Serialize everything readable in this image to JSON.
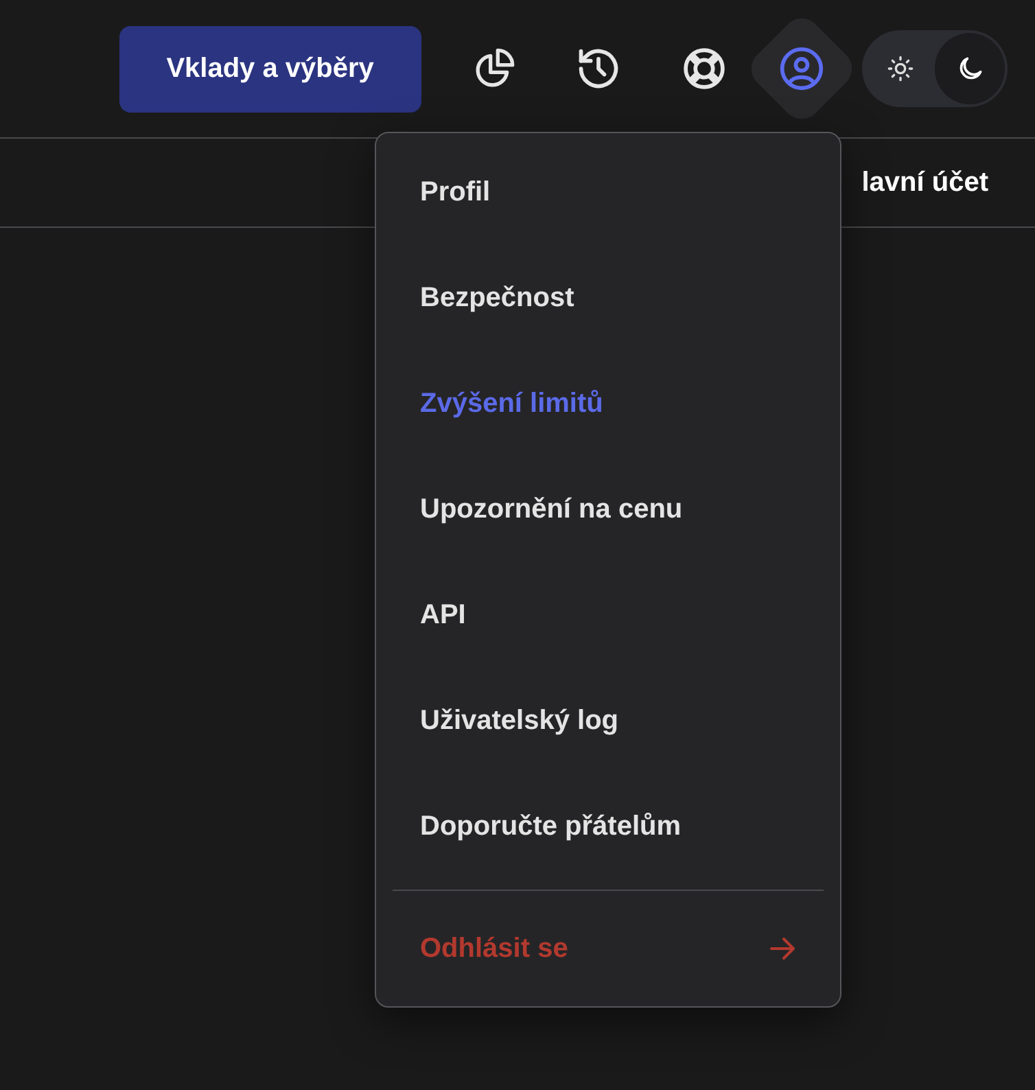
{
  "header": {
    "deposit_button": "Vklady a výběry",
    "icons": [
      {
        "kind": "portfolio",
        "selected": false
      },
      {
        "kind": "history",
        "selected": false
      },
      {
        "kind": "support",
        "selected": false
      },
      {
        "kind": "profile",
        "selected": true
      }
    ],
    "theme_toggle": {
      "dark": true
    }
  },
  "account_label": "lavní účet",
  "menu": {
    "items": [
      {
        "label": "Profil",
        "selected": false
      },
      {
        "label": "Bezpečnost",
        "selected": false
      },
      {
        "label": "Zvýšení limitů",
        "selected": true
      },
      {
        "label": "Upozornění na cenu",
        "selected": false
      },
      {
        "label": "API",
        "selected": false
      },
      {
        "label": "Uživatelský log",
        "selected": false
      },
      {
        "label": "Doporučte přátelům",
        "selected": false
      }
    ],
    "logout": "Odhlásit se"
  }
}
